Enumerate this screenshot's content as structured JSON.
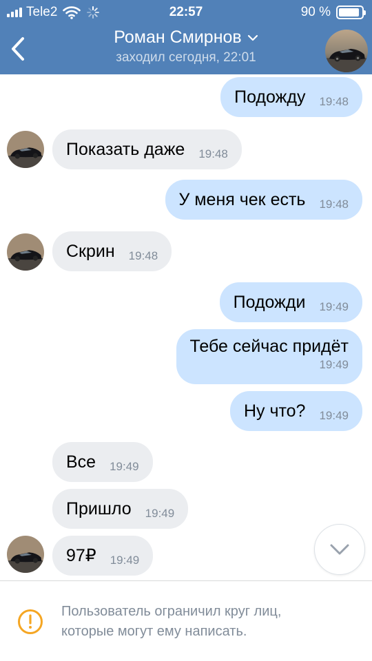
{
  "status_bar": {
    "carrier": "Tele2",
    "time": "22:57",
    "battery_percent": "90 %",
    "battery_level": 0.9,
    "signal_bars": 4
  },
  "header": {
    "contact_name": "Роман Смирнов",
    "last_seen": "заходил сегодня, 22:01",
    "background_color": "#5181b8",
    "back_icon": "chevron-left-icon",
    "name_dropdown_icon": "chevron-down-icon"
  },
  "messages": [
    {
      "direction": "out",
      "text": "Подожду",
      "time": "19:48"
    },
    {
      "direction": "in",
      "text": "Показать даже",
      "time": "19:48"
    },
    {
      "direction": "out",
      "text": "У меня чек есть",
      "time": "19:48"
    },
    {
      "direction": "in",
      "text": "Скрин",
      "time": "19:48"
    },
    {
      "direction": "out",
      "text": "Подожди",
      "time": "19:49"
    },
    {
      "direction": "out",
      "text": "Тебе сейчас придёт",
      "time": "19:49"
    },
    {
      "direction": "out",
      "text": "Ну что?",
      "time": "19:49"
    },
    {
      "direction": "in",
      "text": "Все",
      "time": "19:49"
    },
    {
      "direction": "in",
      "text": "Пришло",
      "time": "19:49"
    },
    {
      "direction": "in",
      "text": "97₽",
      "time": "19:49"
    }
  ],
  "colors": {
    "outgoing_bubble": "#cce4ff",
    "incoming_bubble": "#ebedf0",
    "timestamp": "#818c99",
    "notice_icon": "#f5a623"
  },
  "scroll_button_icon": "chevron-down-icon",
  "footer": {
    "notice_icon": "alert-circle-icon",
    "notice_line1": "Пользователь ограничил круг лиц,",
    "notice_line2": "которые могут ему написать."
  }
}
